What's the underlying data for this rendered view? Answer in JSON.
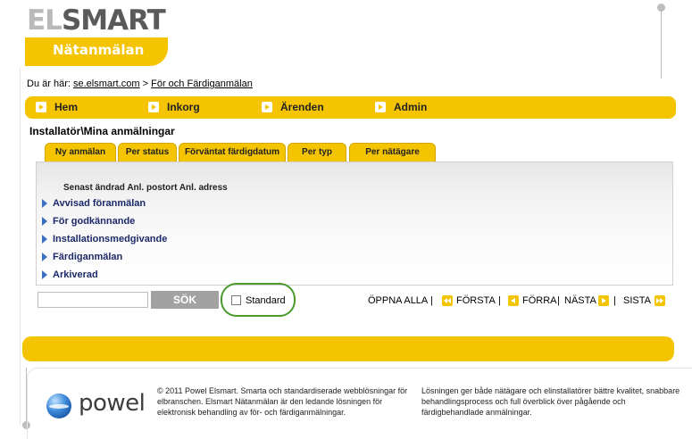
{
  "logo": {
    "brand_light": "EL",
    "brand_dark": "SMART",
    "tagline": "Nätanmälan"
  },
  "breadcrumb": {
    "prefix": "Du är här:",
    "home_link": "se.elsmart.com",
    "separator": ">",
    "current_link": "För och Färdiganmälan"
  },
  "mainnav": {
    "items": [
      {
        "label": "Hem"
      },
      {
        "label": "Inkorg"
      },
      {
        "label": "Ärenden"
      },
      {
        "label": "Admin"
      }
    ]
  },
  "page_title": "Installatör\\Mina anmälningar",
  "tabs": [
    {
      "label": "Ny anmälan"
    },
    {
      "label": "Per status"
    },
    {
      "label": "Förväntat färdigdatum"
    },
    {
      "label": "Per typ"
    },
    {
      "label": "Per nätägare"
    }
  ],
  "grid": {
    "column_headers": "Senast ändrad Anl. postort Anl. adress",
    "groups": [
      {
        "label": "Avvisad föranmälan"
      },
      {
        "label": "För godkännande"
      },
      {
        "label": "Installationsmedgivande"
      },
      {
        "label": "Färdiganmälan"
      },
      {
        "label": "Arkiverad"
      }
    ]
  },
  "toolbar": {
    "search_value": "",
    "search_button": "SÖK",
    "standard_label": "Standard",
    "standard_checked": false,
    "open_all": "ÖPPNA ALLA",
    "sep": "|",
    "first": "FÖRSTA",
    "prev": "FÖRRA",
    "next": "NÄSTA",
    "last": "SISTA"
  },
  "footer": {
    "brand": "powel",
    "copyright": "© 2011 Powel Elsmart. Smarta och standardiserade webblösningar för elbranschen. Elsmart Nätanmälan är den ledande lösningen för elektronisk behandling av för- och färdiganmälningar.",
    "description": "Lösningen ger både nätägare och elinstallatörer bättre kvalitet, snabbare behandlingsprocess och full överblick över pågående och färdigbehandlade anmälningar."
  },
  "colors": {
    "accent": "#f5c400",
    "link_blue": "#1c2a6b",
    "highlight_green": "#4a9a2c"
  }
}
